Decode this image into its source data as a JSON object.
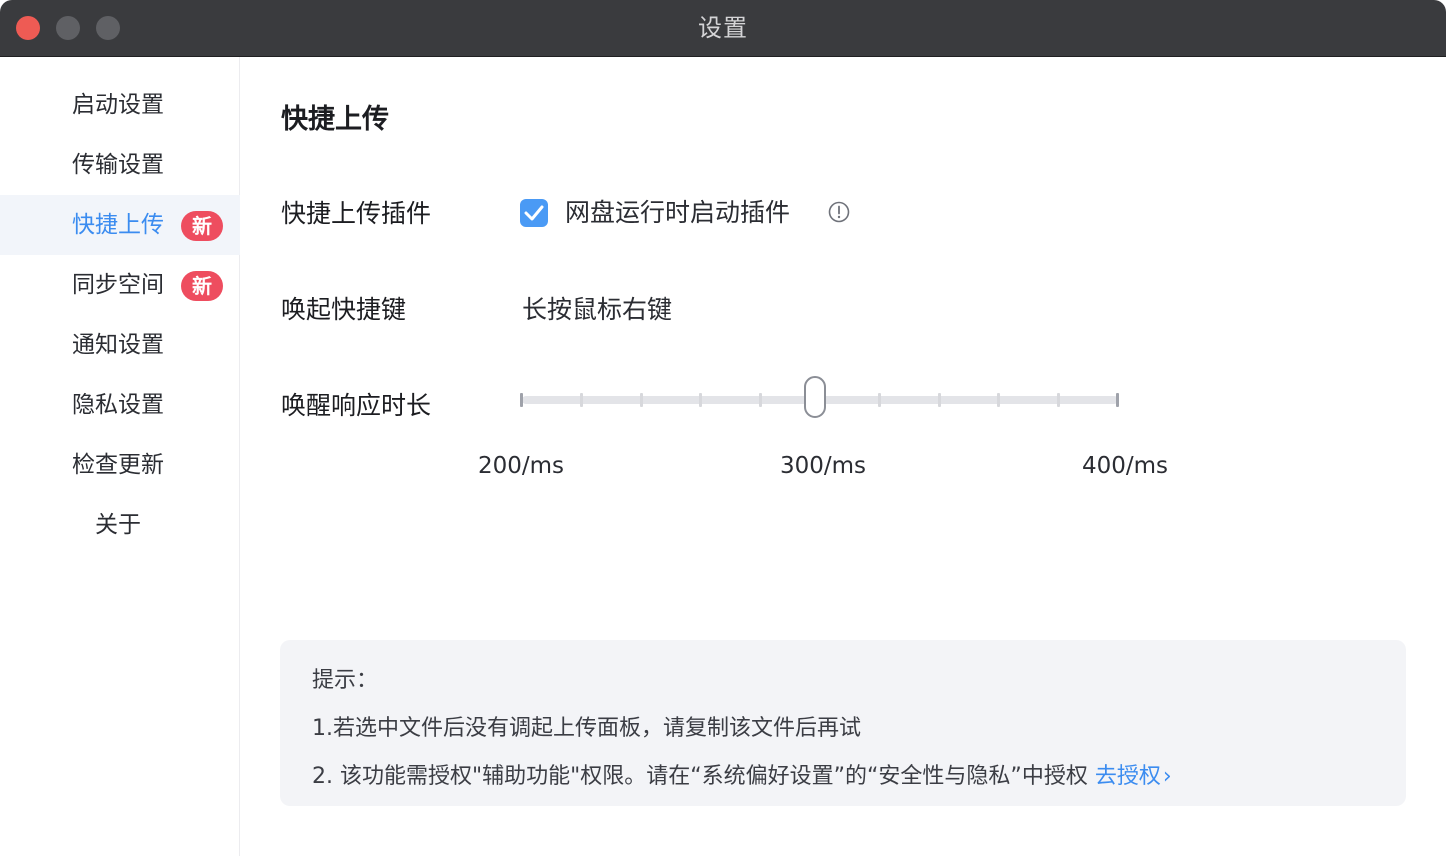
{
  "window": {
    "title": "设置"
  },
  "sidebar": {
    "items": [
      {
        "label": "启动设置"
      },
      {
        "label": "传输设置"
      },
      {
        "label": "快捷上传",
        "badge": "新",
        "active": true
      },
      {
        "label": "同步空间",
        "badge": "新"
      },
      {
        "label": "通知设置"
      },
      {
        "label": "隐私设置"
      },
      {
        "label": "检查更新"
      },
      {
        "label": "关于"
      }
    ]
  },
  "main": {
    "section_title": "快捷上传",
    "plugin": {
      "label": "快捷上传插件",
      "checkbox_label": "网盘运行时启动插件",
      "checked": true
    },
    "shortcut": {
      "label": "唤起快捷键",
      "value": "长按鼠标右键"
    },
    "response": {
      "label": "唤醒响应时长",
      "min_label": "200/ms",
      "mid_label": "300/ms",
      "max_label": "400/ms",
      "value_ms": 300
    },
    "tips": {
      "title": "提示：",
      "line1": "1.若选中文件后没有调起上传面板，请复制该文件后再试",
      "line2": "2. 该功能需授权\"辅助功能\"权限。请在“系统偏好设置”的“安全性与隐私”中授权",
      "link": "去授权"
    }
  },
  "colors": {
    "accent": "#3b8cf0",
    "badge": "#ee4d5f",
    "checkbox": "#4a9af5"
  }
}
